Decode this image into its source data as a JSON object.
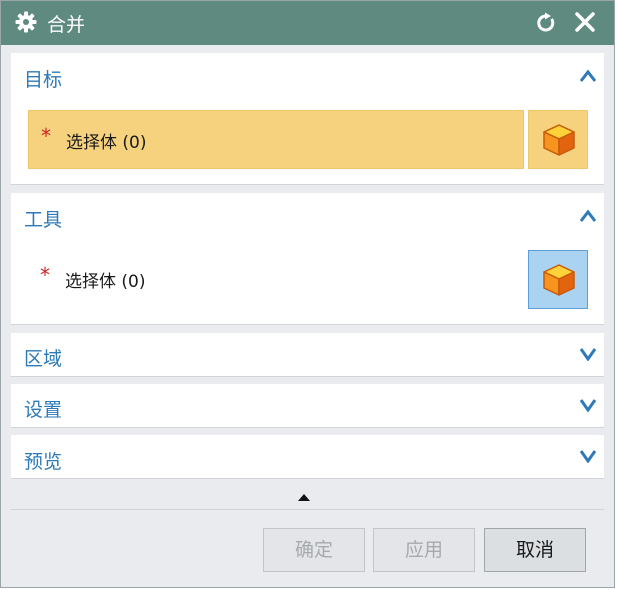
{
  "title_bar": {
    "title": "合并",
    "settings_icon": "gear-icon",
    "reset_icon": "reset-icon",
    "close_icon": "close-icon",
    "color": "#5e8a80"
  },
  "sections": {
    "target": {
      "title": "目标",
      "expanded": true,
      "required_marker": "*",
      "select_label": "选择体 (0)",
      "active": true
    },
    "tool": {
      "title": "工具",
      "expanded": true,
      "required_marker": "*",
      "select_label": "选择体 (0)",
      "active": false
    },
    "region": {
      "title": "区域",
      "expanded": false
    },
    "settings": {
      "title": "设置",
      "expanded": false
    },
    "preview": {
      "title": "预览",
      "expanded": false
    }
  },
  "buttons": {
    "ok": "确定",
    "apply": "应用",
    "cancel": "取消"
  },
  "colors": {
    "accent_text": "#2e7ab8",
    "active_highlight": "#f7d27e",
    "selection_button": "#a9d3f1",
    "required_star": "#d42222"
  }
}
